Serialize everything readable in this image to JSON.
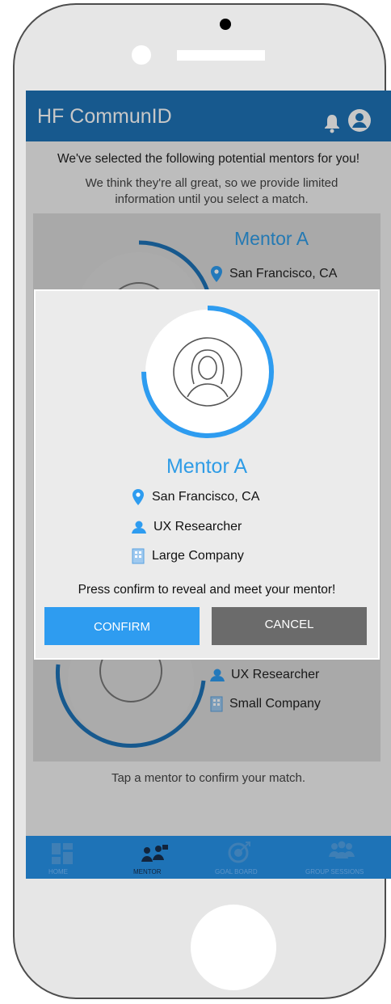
{
  "app": {
    "title": "HF CommunID"
  },
  "header_icons": {
    "notifications": "bell-icon",
    "profile": "user-circle-icon"
  },
  "intro": {
    "title": "We've selected the following potential mentors for you!",
    "subtitle": "We think they're all great, so we provide limited information until you select a match."
  },
  "background_cards": {
    "top": {
      "name": "Mentor A",
      "location": "San Francisco, CA"
    },
    "bottom": {
      "role": "UX Researcher",
      "company": "Small Company"
    }
  },
  "footer_hint": "Tap a mentor to confirm your match.",
  "modal": {
    "name": "Mentor A",
    "location": "San Francisco, CA",
    "role": "UX Researcher",
    "company": "Large Company",
    "prompt": "Press confirm to reveal and meet your mentor!",
    "confirm_label": "CONFIRM",
    "cancel_label": "CANCEL",
    "match_progress": 0.75
  },
  "nav": {
    "items": [
      {
        "label": "HOME",
        "icon": "dashboard-icon",
        "active": false
      },
      {
        "label": "MENTOR",
        "icon": "mentor-icon",
        "active": true
      },
      {
        "label": "GOAL BOARD",
        "icon": "target-icon",
        "active": false
      },
      {
        "label": "GROUP SESSIONS",
        "icon": "group-icon",
        "active": false
      }
    ]
  },
  "colors": {
    "primary": "#1e73b7",
    "accent": "#2e9cf0",
    "cancel": "#6b6b6b",
    "nav_active": "#12243c"
  }
}
